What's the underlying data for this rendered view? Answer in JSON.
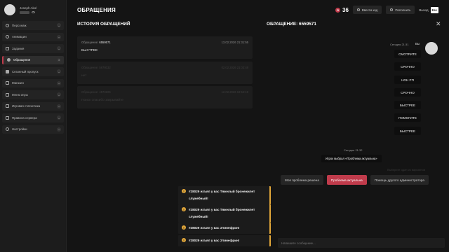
{
  "profile": {
    "name": "Joseph Akol"
  },
  "sidebar": {
    "items": [
      {
        "label": "Персонаж"
      },
      {
        "label": "Анимации"
      },
      {
        "label": "Задания"
      },
      {
        "label": "Обращения",
        "badge": "3"
      },
      {
        "label": "Сезонный пропуск"
      },
      {
        "label": "Магазин"
      },
      {
        "label": "Меню игры"
      },
      {
        "label": "Игровая статистика"
      },
      {
        "label": "Правила сервера"
      },
      {
        "label": "Настройки"
      }
    ]
  },
  "header": {
    "title": "ОБРАЩЕНИЯ",
    "coin_symbol": "R",
    "coins": "36",
    "promo_label": "Ввести код",
    "topup_label": "Пополнить",
    "exit_label": "Выход",
    "exit_key": "Esc"
  },
  "history": {
    "title": "ИСТОРИЯ ОБРАЩЕНИЙ",
    "tickets": [
      {
        "label": "Обращение:",
        "number": "6559571",
        "date": "13.02.2026 21:31:55",
        "message": "БЫСТРЕЕ"
      },
      {
        "label": "Обращение:",
        "number": "5678032",
        "date": "02.02.2026 21:03:48",
        "message": "нет"
      },
      {
        "label": "Обращение:",
        "number": "4573105",
        "date": "12.02.2026 19:54:19",
        "message": "Поиск спасибо закрывайте"
      }
    ]
  },
  "appeal": {
    "title": "ОБРАЩЕНИЕ: 6559571",
    "time_label": "Сегодня 21:31",
    "you_label": "Вы",
    "messages": [
      "СМОТРИТЕ",
      "СРОЧНО",
      "НОН РП",
      "СРОЧНО",
      "БЫСТРЕЕ",
      "ПОМОГИТЕ",
      "БЫСТРЕЕ"
    ],
    "system_time": "Сегодня 21:32",
    "system_message": "Игрок выбрал «Проблема актуальна»",
    "hint": "Выберите один из вариантов",
    "options": [
      "Моя проблема решена",
      "Проблема актуальна",
      "Помощь другого администратора"
    ],
    "input_placeholder": "Напишите сообщение..."
  },
  "notifications": [
    {
      "icon": "!",
      "text": "#28029 изъял у вас Тяжелый бронежилет служебный!"
    },
    {
      "icon": "!",
      "text": "#28029 изъял у вас Тяжелый бронежилет служебный!"
    },
    {
      "icon": "!",
      "text": "#28029 изъял у вас Этинефрин!"
    },
    {
      "icon": "!",
      "text": "#28029 изъял у вас Этинефрин!"
    }
  ],
  "colors": {
    "accent": "#c03b4b",
    "warning": "#e3a83a"
  }
}
